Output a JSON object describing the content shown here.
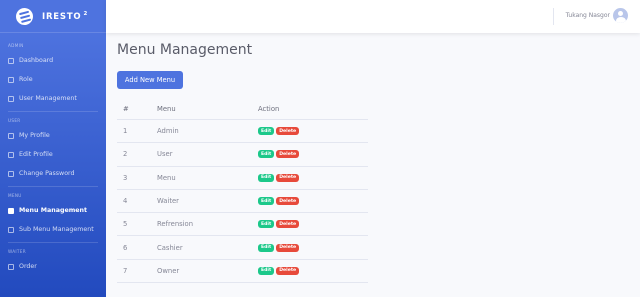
{
  "brand": {
    "name": "IRESTO",
    "sup": "2"
  },
  "sidebar": {
    "sections": [
      {
        "heading": "ADMIN",
        "items": [
          {
            "label": "Dashboard",
            "icon": "dashboard-icon"
          },
          {
            "label": "Role",
            "icon": "user-icon"
          },
          {
            "label": "User Management",
            "icon": "users-icon"
          }
        ]
      },
      {
        "heading": "USER",
        "items": [
          {
            "label": "My Profile",
            "icon": "user-icon"
          },
          {
            "label": "Edit Profile",
            "icon": "user-edit-icon"
          },
          {
            "label": "Change Password",
            "icon": "key-icon"
          }
        ]
      },
      {
        "heading": "MENU",
        "items": [
          {
            "label": "Menu Management",
            "icon": "folder-icon",
            "active": true
          },
          {
            "label": "Sub Menu Management",
            "icon": "folder-open-icon"
          }
        ]
      },
      {
        "heading": "WAITER",
        "items": [
          {
            "label": "Order",
            "icon": "cart-icon"
          }
        ]
      }
    ]
  },
  "topbar": {
    "user_name": "Tukang Nasgor"
  },
  "main": {
    "title": "Menu Management",
    "add_button": "Add New Menu",
    "table": {
      "headers": [
        "#",
        "Menu",
        "Action"
      ],
      "rows": [
        {
          "num": "1",
          "menu": "Admin"
        },
        {
          "num": "2",
          "menu": "User"
        },
        {
          "num": "3",
          "menu": "Menu"
        },
        {
          "num": "4",
          "menu": "Waiter"
        },
        {
          "num": "5",
          "menu": "Refrension"
        },
        {
          "num": "6",
          "menu": "Cashier"
        },
        {
          "num": "7",
          "menu": "Owner"
        }
      ],
      "edit_label": "Edit",
      "delete_label": "Delete"
    }
  },
  "colors": {
    "primary": "#4e73df",
    "success": "#1cc88a",
    "danger": "#e74a3b"
  }
}
